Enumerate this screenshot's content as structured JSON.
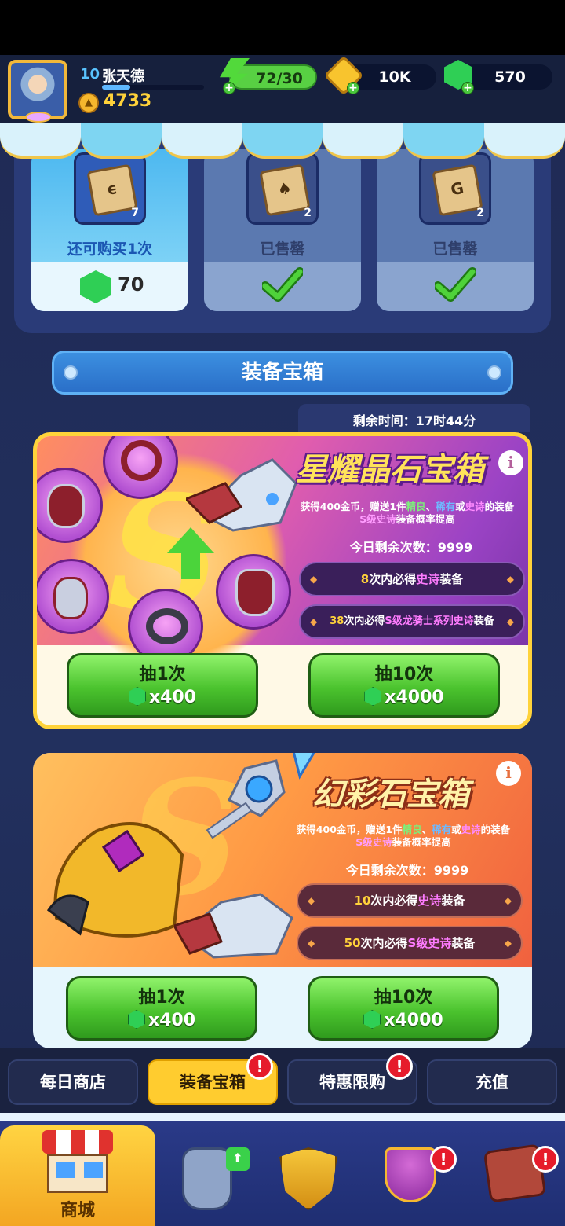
{
  "player": {
    "level": "10",
    "name": "张天德",
    "power": "4733",
    "xp_progress": 0.28
  },
  "resources": {
    "energy": "72/30",
    "gold": "10K",
    "gems": "570"
  },
  "scroll_offers": [
    {
      "count": "7",
      "status": "还可购买1次",
      "price": "70",
      "sold": false
    },
    {
      "count": "2",
      "status": "已售罄",
      "sold": true
    },
    {
      "count": "2",
      "status": "已售罄",
      "sold": true
    }
  ],
  "section_title": "装备宝箱",
  "timer": "剩余时间：17时44分",
  "chests": [
    {
      "title": "星耀晶石宝箱",
      "desc_prefix": "获得400金币，赠送1件",
      "desc_good": "精良",
      "desc_sep": "、",
      "desc_rare": "稀有",
      "desc_or": "或",
      "desc_epic": "史诗",
      "desc_suffix": "的装备",
      "desc_line2_s": "S级史诗",
      "desc_line2": "装备概率提高",
      "remain": "今日剩余次数：9999",
      "pity1_n": "8",
      "pity1_a": "次内必得",
      "pity1_b": "史诗",
      "pity1_c": "装备",
      "pity2_n": "38",
      "pity2_a": "次内必得",
      "pity2_b": "S级龙骑士系列史诗",
      "pity2_c": "装备",
      "btn1_label": "抽1次",
      "btn1_cost": "x400",
      "btn10_label": "抽10次",
      "btn10_cost": "x4000"
    },
    {
      "title": "幻彩石宝箱",
      "desc_prefix": "获得400金币，赠送1件",
      "desc_good": "精良",
      "desc_sep": "、",
      "desc_rare": "稀有",
      "desc_or": "或",
      "desc_epic": "史诗",
      "desc_suffix": "的装备",
      "desc_line2_s": "S级史诗",
      "desc_line2": "装备概率提高",
      "remain": "今日剩余次数：9999",
      "pity1_n": "10",
      "pity1_a": "次内必得",
      "pity1_b": "史诗",
      "pity1_c": "装备",
      "pity2_n": "50",
      "pity2_a": "次内必得",
      "pity2_b": "S级史诗",
      "pity2_c": "装备",
      "btn1_label": "抽1次",
      "btn1_cost": "x400",
      "btn10_label": "抽10次",
      "btn10_cost": "x4000"
    }
  ],
  "tabs": [
    {
      "label": "每日商店",
      "selected": false,
      "badge": ""
    },
    {
      "label": "装备宝箱",
      "selected": true,
      "badge": "!"
    },
    {
      "label": "特惠限购",
      "selected": false,
      "badge": "!"
    },
    {
      "label": "充值",
      "selected": false,
      "badge": ""
    }
  ],
  "nav": {
    "home_label": "商城",
    "badge": "!",
    "up": "⬆"
  },
  "icons": {
    "check": "check-icon",
    "gem": "gem-icon",
    "info": "info-icon"
  },
  "colors": {
    "accent_gold": "#ffcc2f",
    "gem_green": "#2fcf55",
    "button_green": "#4bc32e"
  }
}
